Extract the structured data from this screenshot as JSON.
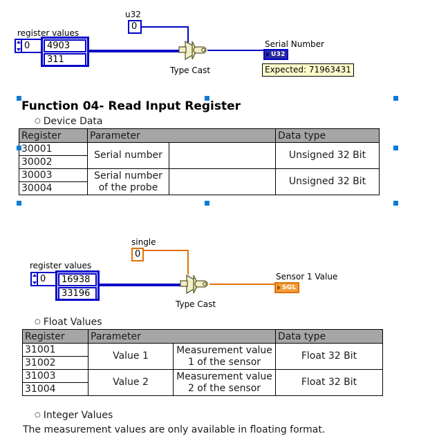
{
  "diagram_1": {
    "name": "type-cast-u32-block-diagram",
    "array_control_label": "register values",
    "index_value": "0",
    "elements": [
      "4903",
      "311"
    ],
    "type_constant_label": "u32",
    "type_constant_value": "0",
    "function_label": "Type Cast",
    "indicator_label": "Serial Number",
    "indicator_type": "U32",
    "tip": "Expected: 71963431",
    "wire_color": "#0000C8"
  },
  "section_heading": "Function 04- Read Input Register",
  "bullets": {
    "device_data": "Device Data",
    "float_values": "Float Values",
    "integer_values": "Integer Values",
    "marker": "○"
  },
  "table_device_data": {
    "headers": [
      "Register",
      "Parameter",
      "",
      "Data type"
    ],
    "rows": [
      {
        "registers": [
          "30001",
          "30002"
        ],
        "parameter": "Serial number",
        "description": "",
        "data_type": "Unsigned 32 Bit"
      },
      {
        "registers": [
          "30003",
          "30004"
        ],
        "parameter": "Serial number\nof the probe",
        "parameter_line1": "Serial number",
        "parameter_line2": "of the probe",
        "description": "",
        "data_type": "Unsigned 32 Bit"
      }
    ],
    "header_bg": "#A6A6A6"
  },
  "diagram_2": {
    "name": "type-cast-single-block-diagram",
    "array_control_label": "register values",
    "index_value": "0",
    "elements": [
      "16938",
      "33196"
    ],
    "type_constant_label": "single",
    "type_constant_value": "0",
    "function_label": "Type Cast",
    "indicator_label": "Sensor 1 Value",
    "indicator_type": "SGL",
    "wire_color_in": "#0000C8",
    "wire_color_out": "#E07000"
  },
  "table_float_values": {
    "headers": [
      "Register",
      "Parameter",
      "",
      "Data type"
    ],
    "rows": [
      {
        "registers": [
          "31001",
          "31002"
        ],
        "parameter": "Value 1",
        "description_line1": "Measurement value",
        "description_line2": "1 of the sensor",
        "data_type": "Float 32 Bit"
      },
      {
        "registers": [
          "31003",
          "31004"
        ],
        "parameter": "Value 2",
        "description_line1": "Measurement value",
        "description_line2": "2 of the sensor",
        "data_type": "Float 32 Bit"
      }
    ],
    "header_bg": "#A6A6A6"
  },
  "closing_paragraph": "The measurement values are only available in floating format.",
  "selection": {
    "handle_color": "#0F7BD4",
    "count": 8
  }
}
